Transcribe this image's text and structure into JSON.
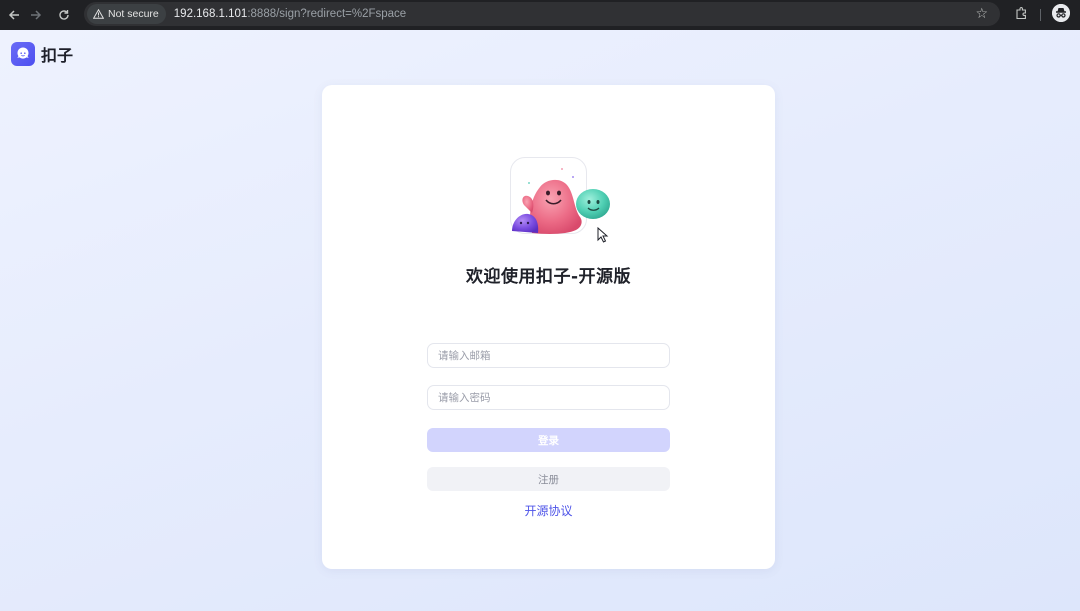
{
  "browser": {
    "security_label": "Not secure",
    "url_host": "192.168.1.101",
    "url_rest": ":8888/sign?redirect=%2Fspace",
    "icons": {
      "back": "arrow-left-icon",
      "forward": "arrow-right-icon",
      "reload": "reload-icon",
      "warning": "warning-triangle-icon",
      "bookmark": "star-icon",
      "extensions": "puzzle-icon",
      "profile": "incognito-icon"
    }
  },
  "brand": {
    "name": "扣子",
    "logo_color": "#5b5df5"
  },
  "login": {
    "title": "欢迎使用扣子-开源版",
    "email_placeholder": "请输入邮箱",
    "password_placeholder": "请输入密码",
    "login_label": "登录",
    "register_label": "注册",
    "agreement_link": "开源协议"
  },
  "colors": {
    "accent": "#4d53e8",
    "login_button_disabled": "#d2d4fd",
    "register_button": "#f1f2f6"
  }
}
